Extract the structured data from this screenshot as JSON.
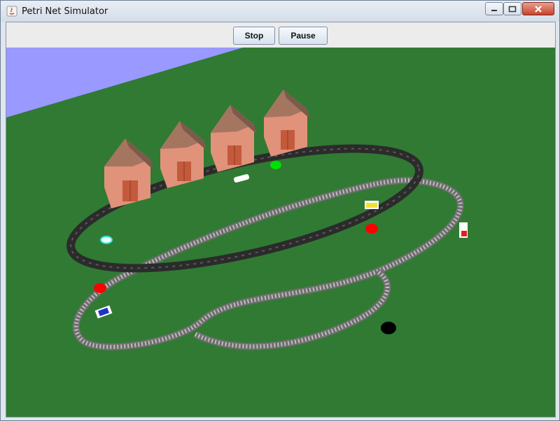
{
  "window": {
    "title": "Petri Net Simulator",
    "icon": "java-icon"
  },
  "window_controls": {
    "minimize": "minimize-icon",
    "maximize": "maximize-icon",
    "close": "close-icon"
  },
  "toolbar": {
    "stop_label": "Stop",
    "pause_label": "Pause"
  },
  "scene": {
    "sky_color": "#9999ff",
    "ground_color": "#317a33",
    "houses": 4,
    "tokens": [
      {
        "color": "#00e000"
      },
      {
        "color": "#ff0000"
      },
      {
        "color": "#ff0000"
      },
      {
        "color": "#000000"
      }
    ]
  }
}
